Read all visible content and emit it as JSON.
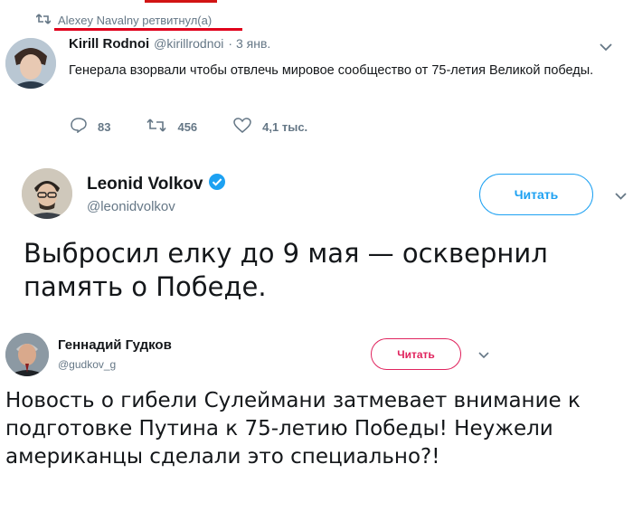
{
  "retweet": {
    "label": "Alexey Navalny ретвитнул(а)",
    "icon": "retweet-icon"
  },
  "tweet1": {
    "author_name": "Kirill Rodnoi",
    "handle": "@kirillrodnoi",
    "date": "· 3 янв.",
    "text": "Генерала взорвали чтобы отвлечь мировое сообщество от  75-летия Великой победы.",
    "replies": "83",
    "retweets": "456",
    "likes": "4,1 тыс."
  },
  "tweet2": {
    "author_name": "Leonid Volkov",
    "handle": "@leonidvolkov",
    "follow_label": "Читать",
    "verified": true,
    "text": "Выбросил елку до 9 мая — осквернил память о Победе."
  },
  "tweet3": {
    "author_name": "Геннадий Гудков",
    "handle": "@gudkov_g",
    "follow_label": "Читать",
    "text": "Новость о гибели Сулеймани затмевает внимание к подготовке Путина к 75-летию Победы! Неужели американцы сделали это специально?!"
  },
  "colors": {
    "accent": "#1da1f2",
    "muted": "#657786",
    "underline_red": "#e0001b",
    "follow3": "#e0245e"
  }
}
